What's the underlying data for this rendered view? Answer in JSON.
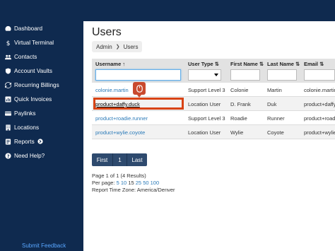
{
  "sidebar": {
    "items": [
      {
        "label": "Dashboard",
        "icon": "dashboard-icon"
      },
      {
        "label": "Virtual Terminal",
        "icon": "dollar-icon"
      },
      {
        "label": "Contacts",
        "icon": "contacts-icon"
      },
      {
        "label": "Account Vaults",
        "icon": "shield-icon"
      },
      {
        "label": "Recurring Billings",
        "icon": "refresh-icon"
      },
      {
        "label": "Quick Invoices",
        "icon": "invoice-icon"
      },
      {
        "label": "Paylinks",
        "icon": "card-icon"
      },
      {
        "label": "Locations",
        "icon": "building-icon"
      },
      {
        "label": "Reports",
        "icon": "reports-icon"
      },
      {
        "label": "Need Help?",
        "icon": "question-icon"
      }
    ],
    "submit_feedback": "Submit Feedback"
  },
  "page": {
    "title": "Users",
    "breadcrumb": [
      "Admin",
      "Users"
    ]
  },
  "table": {
    "headers": {
      "username": "Username ↑",
      "user_type": "User Type ⇅",
      "first_name": "First Name ⇅",
      "last_name": "Last Name ⇅",
      "email": "Email ⇅"
    },
    "rows": [
      {
        "username": "colonie.martin",
        "user_type": "Support Level 3",
        "first_name": "Colonie",
        "last_name": "Martin",
        "email": "colonie.martin"
      },
      {
        "username": "product+daffy.duck",
        "user_type": "Location User",
        "first_name": "D. Frank",
        "last_name": "Duk",
        "email": "product+daffy"
      },
      {
        "username": "product+roadie.runner",
        "user_type": "Support Level 3",
        "first_name": "Roadie",
        "last_name": "Runner",
        "email": "product+roadi"
      },
      {
        "username": "product+wylie.coyote",
        "user_type": "Location User",
        "first_name": "Wylie",
        "last_name": "Coyote",
        "email": "product+wylie"
      }
    ]
  },
  "pager": {
    "first": "First",
    "current": "1",
    "last": "Last"
  },
  "info": {
    "page_summary": "Page 1 of 1 (4 Results)",
    "per_page_label": "Per page:",
    "per_page_options": [
      "5",
      "10",
      "15",
      "25",
      "50",
      "100"
    ],
    "per_page_selected": "15",
    "timezone": "Report Time Zone: America/Denver"
  },
  "colors": {
    "sidebar_bg": "#0f2a4f",
    "link": "#2a7ab8",
    "highlight": "#d84315",
    "pager_bg": "#2e4a6e"
  }
}
